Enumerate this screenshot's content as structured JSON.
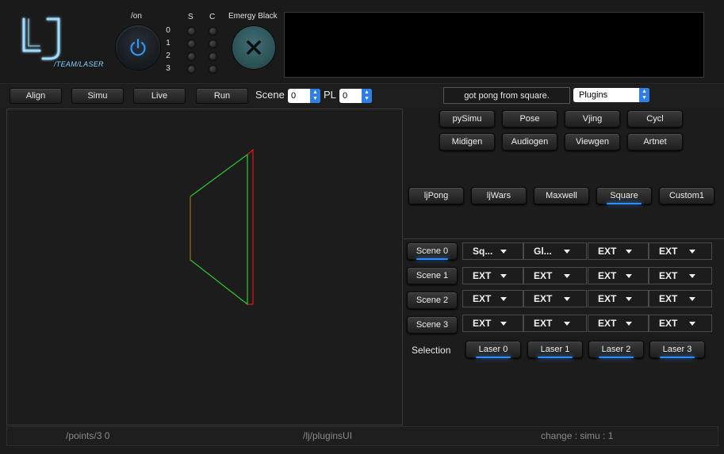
{
  "header": {
    "logo_text": "LJ",
    "logo_subtitle": "/TEAM/LASER",
    "on_label": "/on",
    "s_label": "S",
    "c_label": "C",
    "rows": [
      "0",
      "1",
      "2",
      "3"
    ],
    "emergency_label": "Emergy Black",
    "power_icon": "power-icon",
    "close_icon": "close-icon"
  },
  "toolbar": {
    "buttons": [
      "Align",
      "Simu",
      "Live",
      "Run"
    ],
    "scene_label": "Scene",
    "scene_value": "0",
    "pl_label": "PL",
    "pl_value": "0",
    "status_text": "got pong from square.",
    "plugins_value": "Plugins"
  },
  "plugins": {
    "row1": [
      "pySimu",
      "Pose",
      "Vjing",
      "Cycl"
    ],
    "row2": [
      "Midigen",
      "Audiogen",
      "Viewgen",
      "Artnet"
    ],
    "row3": [
      "ljPong",
      "ljWars",
      "Maxwell",
      "Square",
      "Custom1"
    ],
    "active": "Square"
  },
  "scenes": {
    "labels": [
      "Scene 0",
      "Scene 1",
      "Scene 2",
      "Scene 3"
    ],
    "active": "Scene 0",
    "cells": [
      [
        "Sq...",
        "Gl...",
        "EXT",
        "EXT"
      ],
      [
        "EXT",
        "EXT",
        "EXT",
        "EXT"
      ],
      [
        "EXT",
        "EXT",
        "EXT",
        "EXT"
      ],
      [
        "EXT",
        "EXT",
        "EXT",
        "EXT"
      ]
    ],
    "selection_label": "Selection",
    "lasers": [
      "Laser 0",
      "Laser 1",
      "Laser 2",
      "Laser 3"
    ]
  },
  "footer": {
    "left": "/points/3 0",
    "center": "/lj/pluginsUI",
    "right": "change : simu : 1"
  },
  "colors": {
    "accent": "#2f8dff",
    "laser_green": "#2ecc2e",
    "laser_red": "#e01818",
    "emergency": "#2d5459"
  }
}
